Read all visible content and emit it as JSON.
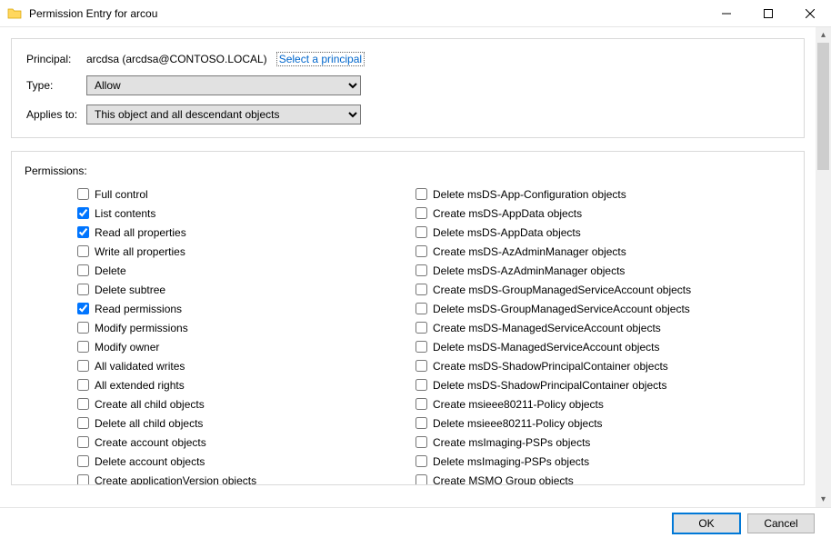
{
  "window": {
    "title": "Permission Entry for arcou"
  },
  "fields": {
    "principal_label": "Principal:",
    "principal_value": "arcdsa (arcdsa@CONTOSO.LOCAL)",
    "select_principal_link": "Select a principal",
    "type_label": "Type:",
    "type_value": "Allow",
    "applies_label": "Applies to:",
    "applies_value": "This object and all descendant objects"
  },
  "permissions_label": "Permissions:",
  "permissions_col1": [
    {
      "label": "Full control",
      "checked": false
    },
    {
      "label": "List contents",
      "checked": true
    },
    {
      "label": "Read all properties",
      "checked": true
    },
    {
      "label": "Write all properties",
      "checked": false
    },
    {
      "label": "Delete",
      "checked": false
    },
    {
      "label": "Delete subtree",
      "checked": false
    },
    {
      "label": "Read permissions",
      "checked": true
    },
    {
      "label": "Modify permissions",
      "checked": false
    },
    {
      "label": "Modify owner",
      "checked": false
    },
    {
      "label": "All validated writes",
      "checked": false
    },
    {
      "label": "All extended rights",
      "checked": false
    },
    {
      "label": "Create all child objects",
      "checked": false
    },
    {
      "label": "Delete all child objects",
      "checked": false
    },
    {
      "label": "Create account objects",
      "checked": false
    },
    {
      "label": "Delete account objects",
      "checked": false
    },
    {
      "label": "Create applicationVersion objects",
      "checked": false
    }
  ],
  "permissions_col2": [
    {
      "label": "Delete msDS-App-Configuration objects",
      "checked": false
    },
    {
      "label": "Create msDS-AppData objects",
      "checked": false
    },
    {
      "label": "Delete msDS-AppData objects",
      "checked": false
    },
    {
      "label": "Create msDS-AzAdminManager objects",
      "checked": false
    },
    {
      "label": "Delete msDS-AzAdminManager objects",
      "checked": false
    },
    {
      "label": "Create msDS-GroupManagedServiceAccount objects",
      "checked": false
    },
    {
      "label": "Delete msDS-GroupManagedServiceAccount objects",
      "checked": false
    },
    {
      "label": "Create msDS-ManagedServiceAccount objects",
      "checked": false
    },
    {
      "label": "Delete msDS-ManagedServiceAccount objects",
      "checked": false
    },
    {
      "label": "Create msDS-ShadowPrincipalContainer objects",
      "checked": false
    },
    {
      "label": "Delete msDS-ShadowPrincipalContainer objects",
      "checked": false
    },
    {
      "label": "Create msieee80211-Policy objects",
      "checked": false
    },
    {
      "label": "Delete msieee80211-Policy objects",
      "checked": false
    },
    {
      "label": "Create msImaging-PSPs objects",
      "checked": false
    },
    {
      "label": "Delete msImaging-PSPs objects",
      "checked": false
    },
    {
      "label": "Create MSMQ Group objects",
      "checked": false
    }
  ],
  "buttons": {
    "ok": "OK",
    "cancel": "Cancel"
  }
}
